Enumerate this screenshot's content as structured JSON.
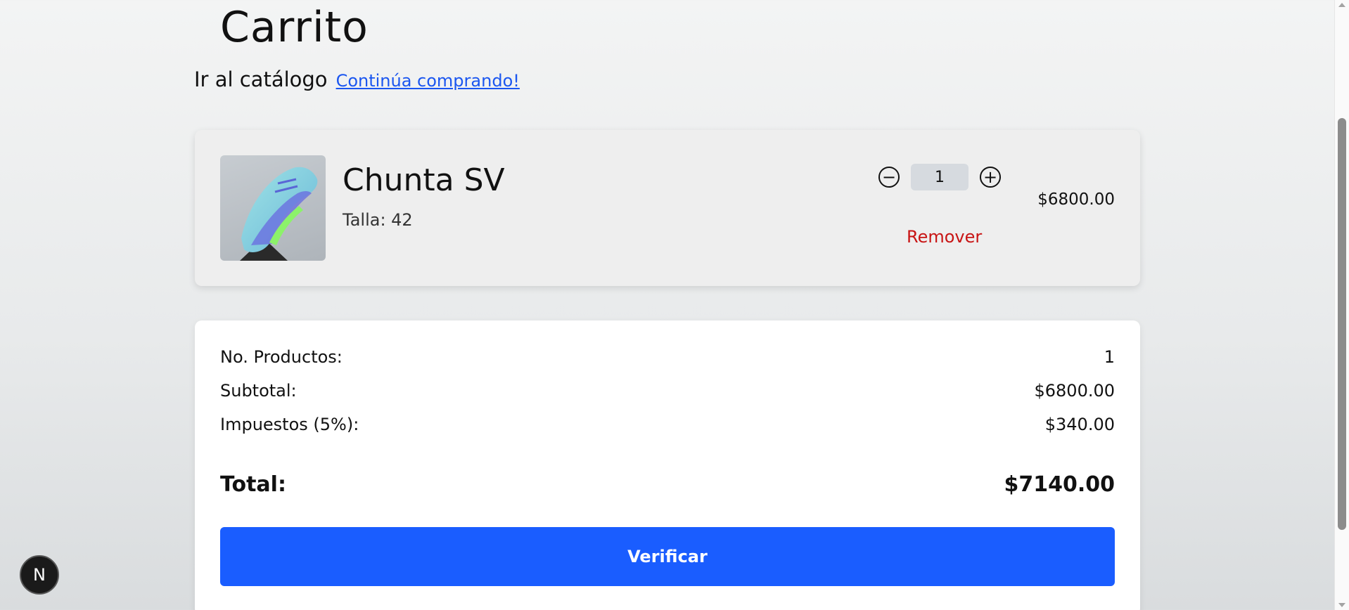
{
  "page": {
    "title": "Carrito",
    "catalog_label": "Ir al catálogo",
    "catalog_link": "Continúa comprando!"
  },
  "cart_items": [
    {
      "name": "Chunta SV",
      "size_label": "Talla: 42",
      "quantity": "1",
      "decrement_icon": "minus-circle-icon",
      "increment_icon": "plus-circle-icon",
      "decrement_glyph": "−",
      "increment_glyph": "+",
      "remove_label": "Remover",
      "price": "$6800.00"
    }
  ],
  "summary": {
    "products_label": "No. Productos:",
    "products_value": "1",
    "subtotal_label": "Subtotal:",
    "subtotal_value": "$6800.00",
    "tax_label": "Impuestos (5%):",
    "tax_value": "$340.00",
    "total_label": "Total:",
    "total_value": "$7140.00",
    "verify_label": "Verificar"
  },
  "dev_badge": {
    "letter": "N",
    "icon": "nextjs-logo-icon"
  },
  "colors": {
    "accent_blue": "#1a5dff",
    "link_blue": "#1a56f0",
    "remove_red": "#c81414"
  }
}
